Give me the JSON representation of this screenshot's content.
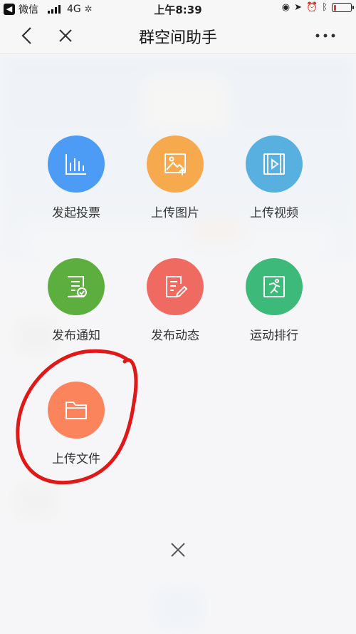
{
  "status_bar": {
    "back_app": "微信",
    "network": "4G",
    "time": "上午8:39",
    "battery_fraction": 0.15
  },
  "nav": {
    "title": "群空间助手",
    "back_icon": "chevron-left-icon",
    "close_icon": "close-icon",
    "more_icon": "more-dots-icon"
  },
  "actions": [
    {
      "label": "发起投票",
      "color": "#4c9bf5",
      "icon": "bar-chart-icon"
    },
    {
      "label": "上传图片",
      "color": "#f7a94e",
      "icon": "image-upload-icon"
    },
    {
      "label": "上传视频",
      "color": "#58b0e0",
      "icon": "video-icon"
    },
    {
      "label": "发布通知",
      "color": "#5cae3e",
      "icon": "notice-icon"
    },
    {
      "label": "发布动态",
      "color": "#ef6b62",
      "icon": "edit-post-icon"
    },
    {
      "label": "运动排行",
      "color": "#3db97a",
      "icon": "sport-ranking-icon"
    },
    {
      "label": "上传文件",
      "color": "#fb845c",
      "icon": "folder-icon"
    }
  ],
  "panel_close_icon": "close-icon",
  "annotation_color": "#e01818"
}
